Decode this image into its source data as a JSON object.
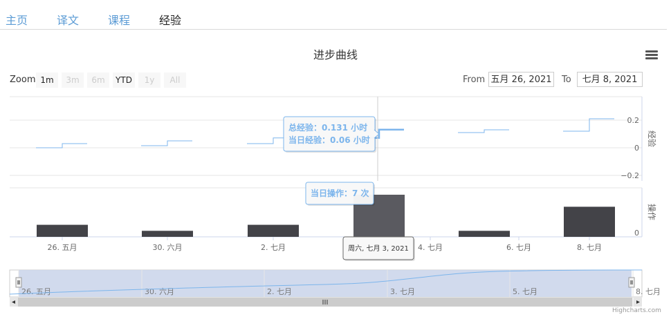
{
  "nav": {
    "tabs": [
      {
        "label": "主页",
        "active": false
      },
      {
        "label": "译文",
        "active": false
      },
      {
        "label": "课程",
        "active": false
      },
      {
        "label": "经验",
        "active": true
      }
    ]
  },
  "title": "进步曲线",
  "menu_icon": "hamburger-menu-icon",
  "range_selector": {
    "zoom_label": "Zoom",
    "buttons": [
      {
        "label": "1m",
        "enabled": true
      },
      {
        "label": "3m",
        "enabled": false
      },
      {
        "label": "6m",
        "enabled": false
      },
      {
        "label": "YTD",
        "enabled": true
      },
      {
        "label": "1y",
        "enabled": false
      },
      {
        "label": "All",
        "enabled": false
      }
    ],
    "from_label": "From",
    "from_value": "五月 26, 2021",
    "to_label": "To",
    "to_value": "七月 8, 2021"
  },
  "tooltips": {
    "line_1": "总经验：0.131 小时",
    "line_2": "当日经验：0.06 小时",
    "bar": "当日操作：7 次",
    "date": "周六, 七月 3, 2021"
  },
  "chart_data": {
    "type": "line",
    "axes": {
      "top_y_label": "经验",
      "top_y_ticks": [
        "0.2",
        "0",
        "−0.2"
      ],
      "top_y_range": [
        -0.2,
        0.2
      ],
      "bottom_y_label": "操作",
      "bottom_y_ticks": [
        "0"
      ],
      "x_ticks": [
        "26. 五月",
        "30. 六月",
        "2. 七月",
        "3. 七月",
        "4. 七月",
        "6. 七月",
        "8. 七月"
      ],
      "navigator_ticks": [
        "26. 五月",
        "30. 六月",
        "2. 七月",
        "3. 七月",
        "5. 七月",
        "8. 七月"
      ]
    },
    "experience": [
      {
        "date": "26. 五月",
        "start": 0.0,
        "end": 0.03
      },
      {
        "date": "30. 六月",
        "start": 0.015,
        "end": 0.05
      },
      {
        "date": "2. 七月",
        "start": 0.03,
        "end": 0.071
      },
      {
        "date": "3. 七月",
        "start": 0.071,
        "end": 0.131
      },
      {
        "date": "6. 七月",
        "start": 0.11,
        "end": 0.13
      },
      {
        "date": "8. 七月",
        "start": 0.12,
        "end": 0.21
      }
    ],
    "operations": [
      {
        "date": "26. 五月",
        "value": 2
      },
      {
        "date": "30. 六月",
        "value": 1
      },
      {
        "date": "2. 七月",
        "value": 2
      },
      {
        "date": "3. 七月",
        "value": 7
      },
      {
        "date": "6. 七月",
        "value": 1
      },
      {
        "date": "8. 七月",
        "value": 5
      }
    ],
    "colors": {
      "line": "#7cb5ec",
      "bar": "#434348",
      "bar_hover": "#5a5a60",
      "navigator_fill": "#ccd6eb",
      "tooltip_text": "#7cb5ec"
    }
  },
  "credits": "Highcharts.com"
}
